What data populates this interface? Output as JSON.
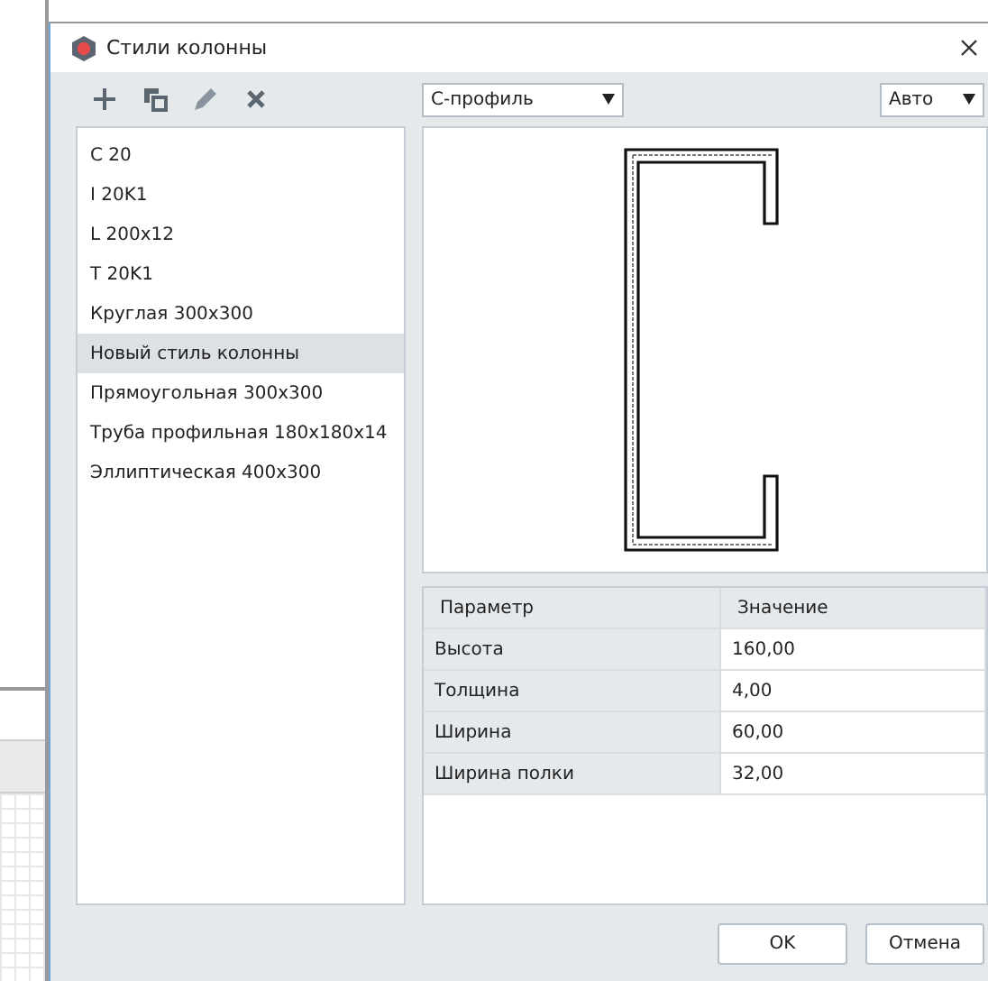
{
  "window": {
    "title": "Стили колонны"
  },
  "toolbar": [
    {
      "kind": "add"
    },
    {
      "kind": "copy"
    },
    {
      "kind": "edit"
    },
    {
      "kind": "delete"
    }
  ],
  "profile_select": {
    "value": "С-профиль"
  },
  "view_select": {
    "value": "Авто"
  },
  "styles": [
    {
      "label": "C 20",
      "selected": false
    },
    {
      "label": "I 20K1",
      "selected": false
    },
    {
      "label": "L 200x12",
      "selected": false
    },
    {
      "label": "T 20K1",
      "selected": false
    },
    {
      "label": "Круглая 300x300",
      "selected": false
    },
    {
      "label": "Новый стиль колонны",
      "selected": true
    },
    {
      "label": "Прямоугольная 300x300",
      "selected": false
    },
    {
      "label": "Труба профильная 180x180x14",
      "selected": false
    },
    {
      "label": "Эллиптическая 400x300",
      "selected": false
    }
  ],
  "table": {
    "columns": [
      "Параметр",
      "Значение"
    ],
    "rows": [
      [
        "Высота",
        "160,00"
      ],
      [
        "Толщина",
        "4,00"
      ],
      [
        "Ширина",
        "60,00"
      ],
      [
        "Ширина полки",
        "32,00"
      ]
    ]
  },
  "buttons": [
    "OK",
    "Отмена"
  ]
}
